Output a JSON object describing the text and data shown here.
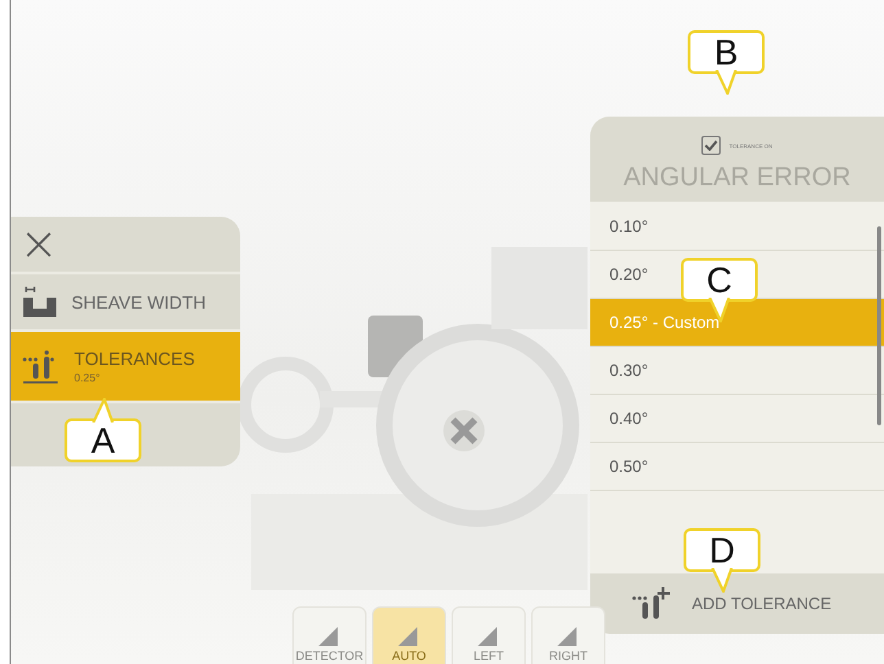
{
  "side_menu": {
    "close": "×",
    "items": [
      {
        "kind": "sheave",
        "label": "SHEAVE WIDTH",
        "selected": false
      },
      {
        "kind": "tolerance",
        "label": "TOLERANCES",
        "value": "0.25°",
        "selected": true
      }
    ]
  },
  "tolerance_panel": {
    "tolerance_on": {
      "label": "TOLERANCE ON",
      "checked": true
    },
    "title": "ANGULAR ERROR",
    "options": [
      {
        "label": "0.10°",
        "selected": false
      },
      {
        "label": "0.20°",
        "selected": false
      },
      {
        "label": "0.25° - Custom",
        "selected": true
      },
      {
        "label": "0.30°",
        "selected": false
      },
      {
        "label": "0.40°",
        "selected": false
      },
      {
        "label": "0.50°",
        "selected": false
      }
    ],
    "add_button": "ADD TOLERANCE"
  },
  "toolbar": [
    {
      "label": "DETECTOR",
      "selected": false
    },
    {
      "label": "AUTO",
      "selected": true
    },
    {
      "label": "LEFT",
      "selected": false
    },
    {
      "label": "RIGHT",
      "selected": false
    }
  ],
  "callouts": [
    {
      "letter": "A"
    },
    {
      "letter": "B"
    },
    {
      "letter": "C"
    },
    {
      "letter": "D"
    }
  ]
}
